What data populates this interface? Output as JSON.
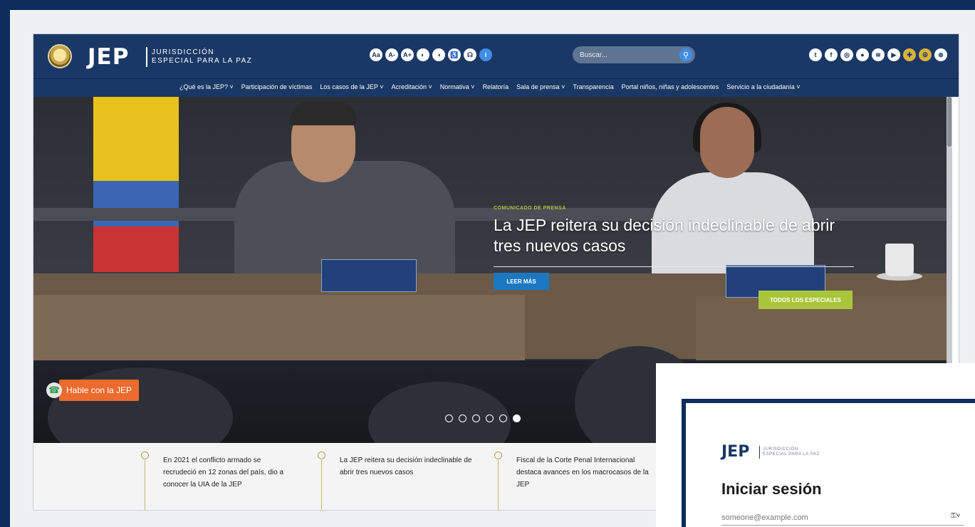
{
  "header": {
    "logo_text": "JEP",
    "logo_sub_line1": "JURISDICCIÓN",
    "logo_sub_line2": "ESPECIAL PARA LA PAZ",
    "search_placeholder": "Buscar...",
    "accessibility_icons": [
      "Aa",
      "A-",
      "A+",
      "◐",
      "◑",
      "♿",
      "👂",
      "ℹ"
    ],
    "social_icons": [
      "twitter",
      "facebook",
      "instagram",
      "flickr",
      "youtube",
      "spotify",
      "gold1",
      "gold2",
      "globe"
    ]
  },
  "nav": {
    "items": [
      "¿Qué es la JEP? ˅",
      "Participación de víctimas",
      "Los casos de la JEP ˅",
      "Acreditación ˅",
      "Normativa ˅",
      "Relatoría",
      "Sala de prensa ˅",
      "Transparencia",
      "Portal niños, niñas y adolescentes",
      "Servicio a la ciudadanía ˅"
    ]
  },
  "hero": {
    "tag": "COMUNICADO DE PRENSA",
    "title": "La JEP reitera su decisión indeclinable de abrir tres nuevos casos",
    "read_more": "LEER MÁS",
    "press_button": "TODOS LOS ESPECIALES",
    "talk_label": "Hable con la JEP",
    "slides": 6,
    "active_slide": 6
  },
  "news": [
    {
      "text": "En 2021 el conflicto armado se recrudeció en 12 zonas del país, dio a conocer la UIA de la JEP"
    },
    {
      "text": "La JEP reitera su decisión indeclinable de abrir tres nuevos casos"
    },
    {
      "text": "Fiscal de la Corte Penal Internacional destaca avances en los macrocasos de la JEP"
    }
  ],
  "login": {
    "logo_text": "JEP",
    "logo_sub_line1": "JURISDICCIÓN",
    "logo_sub_line2": "ESPECIAL PARA LA PAZ",
    "title": "Iniciar sesión",
    "email_placeholder": "someone@example.com",
    "key_glyph": "🔑˅"
  },
  "colors": {
    "brand_navy": "#1a3865",
    "accent_orange": "#ec6b2d",
    "accent_green": "#a9c63b",
    "button_blue": "#1b78c0"
  }
}
